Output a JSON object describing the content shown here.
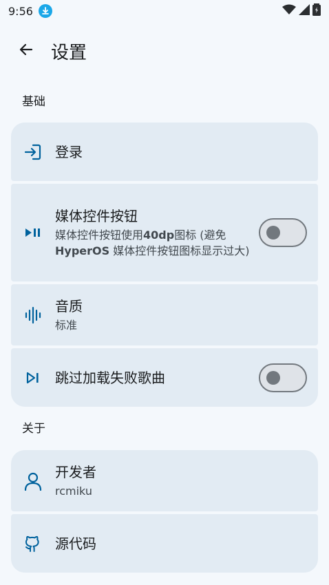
{
  "status": {
    "time": "9:56"
  },
  "header": {
    "title": "设置"
  },
  "sections": {
    "basic": {
      "label": "基础",
      "login": {
        "title": "登录"
      },
      "media_buttons": {
        "title": "媒体控件按钮",
        "subtitle_a": "媒体控件按钮使用",
        "subtitle_b": "40dp",
        "subtitle_c": "图标 (避免",
        "subtitle_d": "HyperOS",
        "subtitle_e": " 媒体控件按钮图标显示过大)",
        "enabled": false
      },
      "audio_quality": {
        "title": "音质",
        "value": "标准"
      },
      "skip_failed": {
        "title": "跳过加载失败歌曲",
        "enabled": false
      }
    },
    "about": {
      "label": "关于",
      "developer": {
        "title": "开发者",
        "value": "rcmiku"
      },
      "source_code": {
        "title": "源代码"
      }
    }
  },
  "colors": {
    "background": "#f4f8fc",
    "card": "#e2ebf3",
    "icon": "#00629d",
    "download_badge": "#1aa7e8"
  },
  "icons": {
    "back": "arrow-back-icon",
    "login": "login-icon",
    "media": "play-pause-icon",
    "audio": "graphic-eq-icon",
    "skip": "skip-next-icon",
    "developer": "person-icon",
    "source": "github-icon"
  }
}
